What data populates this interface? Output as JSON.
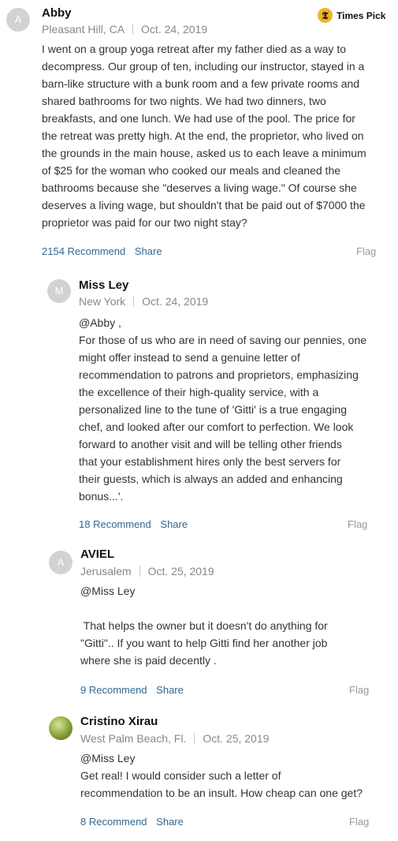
{
  "times_pick": {
    "icon": "nyt-t-icon",
    "label": "Times Pick"
  },
  "comments": [
    {
      "avatar_letter": "A",
      "name": "Abby",
      "location": "Pleasant Hill, CA",
      "date": "Oct. 24, 2019",
      "body": [
        "I went on a group yoga retreat after my father died as a way to",
        "decompress.  Our group of ten, including our instructor, stayed in a",
        "barn-like structure with a bunk room and a few private rooms and",
        "shared bathrooms for two nights.  We had two dinners, two",
        "breakfasts, and one lunch.  We had use of the pool.  The price for",
        "the retreat was pretty high.  At the end, the proprietor, who lived on",
        "the grounds in the main house, asked us to each leave a minimum",
        "of $25 for the woman who cooked our meals and cleaned the",
        "bathrooms because she \"deserves a living wage.\"  Of course she",
        "deserves a living wage, but shouldn't that be paid out of $7000 the",
        "proprietor was paid for our two night stay?"
      ],
      "recommend": "2154 Recommend",
      "share": "Share",
      "flag": "Flag"
    },
    {
      "avatar_letter": "M",
      "name": "Miss Ley",
      "location": "New York",
      "date": "Oct. 24, 2019",
      "body": [
        "@Abby ,",
        "For those of us who are in need of saving our pennies, one",
        "might offer instead to send a genuine letter of",
        "recommendation to patrons and proprietors, emphasizing",
        "the excellence of their high-quality service, with a",
        "personalized line to the tune of 'Gitti' is a true engaging",
        "chef, and looked after our comfort to perfection.  We look",
        "forward to another visit and will be telling other friends",
        "that your establishment hires only the best servers for",
        "their guests, which is always an added and enhancing",
        "bonus...'."
      ],
      "recommend": "18 Recommend",
      "share": "Share",
      "flag": "Flag"
    },
    {
      "avatar_letter": "A",
      "name": "AVIEL",
      "location": "Jerusalem",
      "date": "Oct. 25, 2019",
      "body": [
        "@Miss Ley",
        "",
        " That helps the owner but it doesn't do anything for",
        "\"Gitti\".. If you want to help Gitti find her another  job",
        "where she is paid decently ."
      ],
      "recommend": "9 Recommend",
      "share": "Share",
      "flag": "Flag"
    },
    {
      "avatar_letter": "",
      "name": "Cristino Xirau",
      "location": "West Palm Beach, Fl.",
      "date": "Oct. 25, 2019",
      "body": [
        "@Miss Ley",
        "Get real! I would consider such a letter of",
        "recommendation to be an insult. How cheap can one get?"
      ],
      "recommend": "8 Recommend",
      "share": "Share",
      "flag": "Flag"
    }
  ]
}
